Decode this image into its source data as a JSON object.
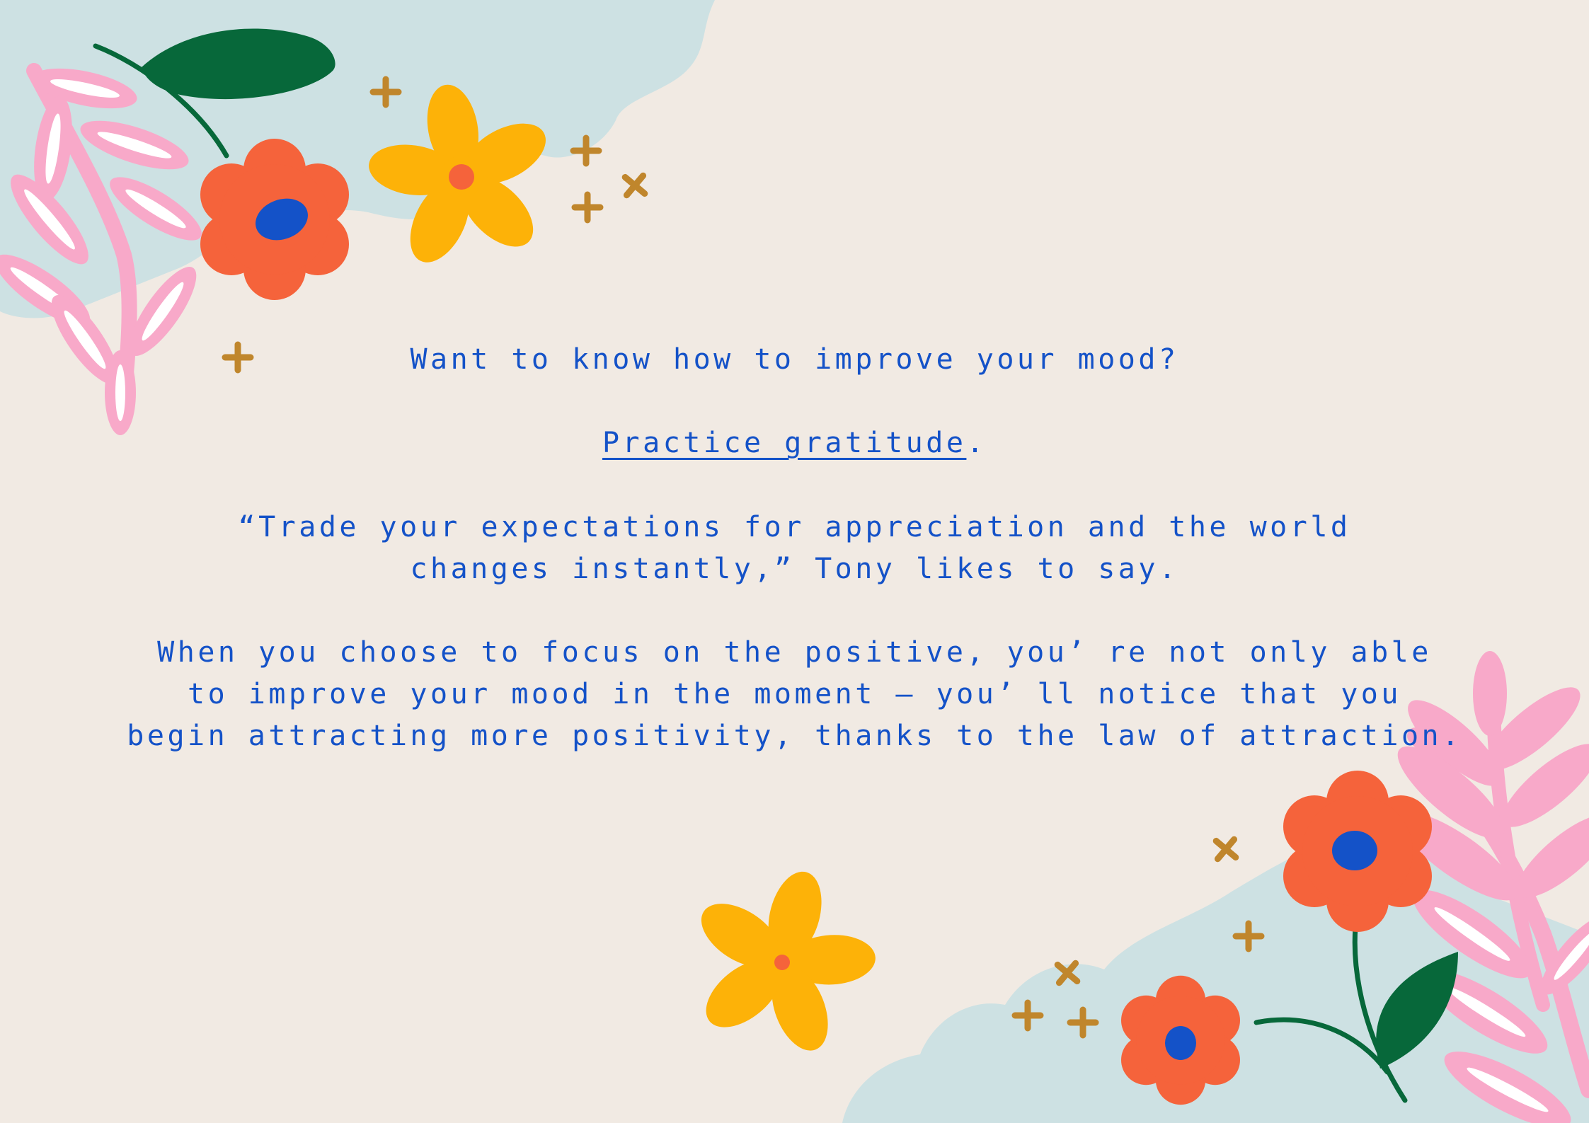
{
  "card": {
    "question": "Want to know how to improve your mood?",
    "answer_link": "Practice gratitude",
    "answer_period": ".",
    "quote_line1": "“Trade your expectations for appreciation and the world",
    "quote_line2": "changes instantly,”  Tony likes to say.",
    "body_line1": "When you choose to focus on the positive, you’ re not only able",
    "body_line2": "to improve your mood in the moment — you’ ll notice that you",
    "body_line3": "begin attracting more positivity, thanks to the law of attraction."
  },
  "decorations": [
    "cloud-shape",
    "fern-leaf-icon",
    "leaf-icon",
    "red-flower-icon",
    "yellow-flower-icon",
    "sparkle-icon"
  ],
  "colors": {
    "background": "#f1eae3",
    "text": "#1452c8",
    "cloud": "#cde1e3",
    "fern": "#f8a9c9",
    "leaf": "#07683a",
    "red_flower": "#f5633b",
    "flower_center": "#1452c8",
    "yellow_flower": "#fdb208",
    "yellow_center": "#f5633b",
    "sparkle": "#c0862c"
  }
}
